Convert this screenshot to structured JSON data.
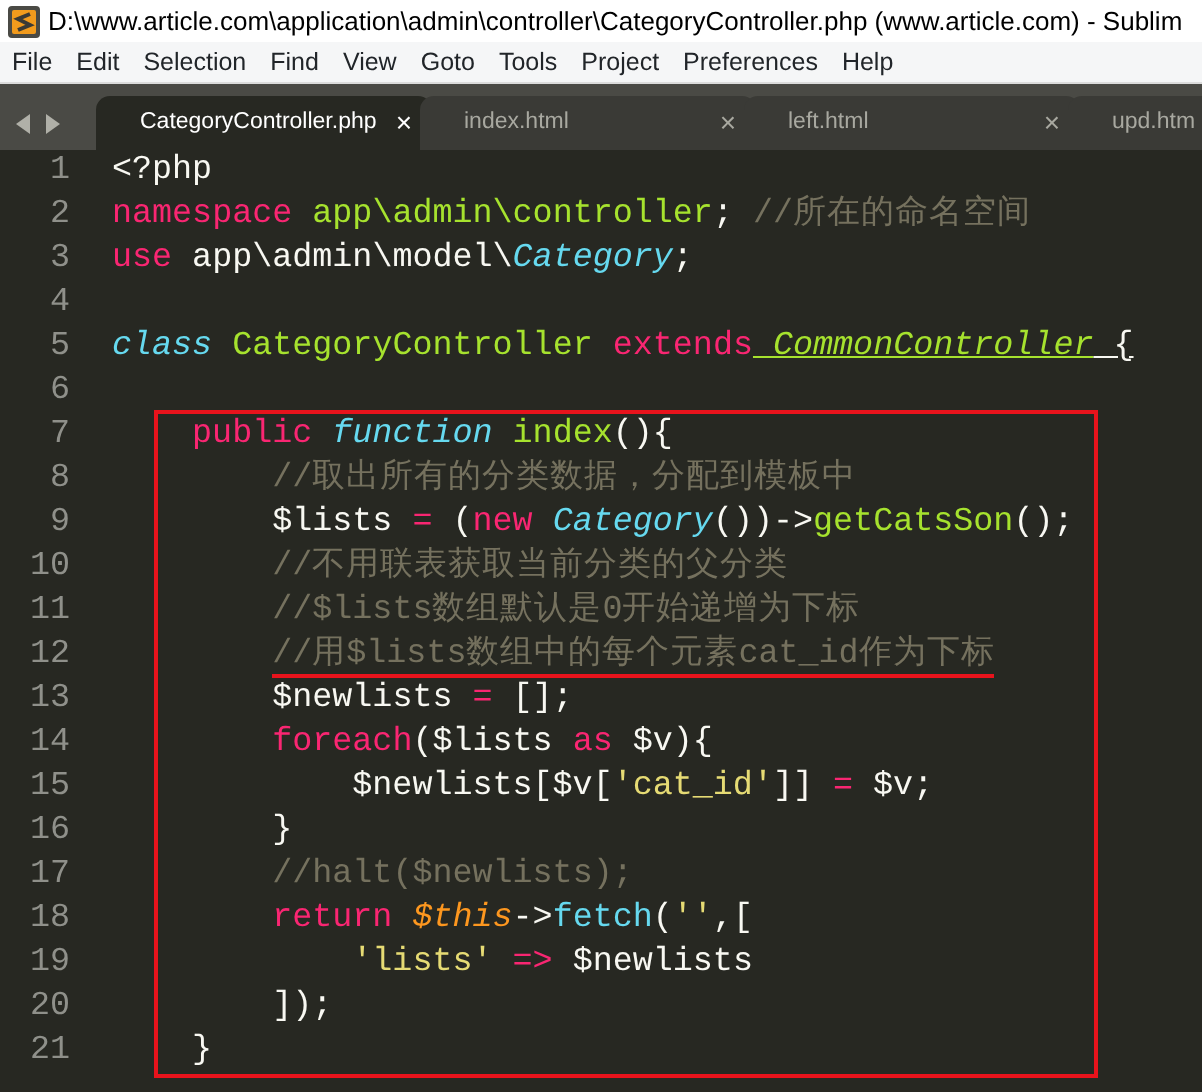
{
  "window": {
    "title": "D:\\www.article.com\\application\\admin\\controller\\CategoryController.php (www.article.com) - Sublim"
  },
  "menu": [
    "File",
    "Edit",
    "Selection",
    "Find",
    "View",
    "Goto",
    "Tools",
    "Project",
    "Preferences",
    "Help"
  ],
  "tabs": [
    {
      "label": "CategoryController.php",
      "close": "×",
      "selected": true
    },
    {
      "label": "index.html",
      "close": "×",
      "selected": false
    },
    {
      "label": "left.html",
      "close": "×",
      "selected": false
    },
    {
      "label": "upd.htm",
      "selected": false
    }
  ],
  "code": {
    "lines": [
      {
        "number": "1",
        "tokens": [
          {
            "kind": "plain",
            "text": "<?php"
          }
        ]
      },
      {
        "number": "2",
        "tokens": [
          {
            "kind": "keyword",
            "text": "namespace"
          },
          {
            "kind": "entity",
            "text": " app\\admin\\controller"
          },
          {
            "kind": "plain",
            "text": ";"
          },
          {
            "kind": "comment",
            "text": " //所在的命名空间"
          }
        ]
      },
      {
        "number": "3",
        "tokens": [
          {
            "kind": "keyword",
            "text": "use"
          },
          {
            "kind": "plain",
            "text": " app\\admin\\model\\"
          },
          {
            "kind": "type",
            "text": "Category"
          },
          {
            "kind": "plain",
            "text": ";"
          }
        ]
      },
      {
        "number": "4"
      },
      {
        "number": "5",
        "tokens": [
          {
            "kind": "type",
            "text": "class"
          },
          {
            "kind": "entity",
            "text": " CategoryController"
          },
          {
            "kind": "keyword",
            "text": " extends"
          },
          {
            "kind": "parent",
            "text": " CommonController"
          },
          {
            "kind": "plain",
            "text": " {",
            "matched_bracket": true
          }
        ],
        "children": [
          {
            "number": "6"
          },
          {
            "boxed": true,
            "lines": [
              {
                "number": "7",
                "tokens": [
                  {
                    "kind": "keyword",
                    "text": "public"
                  },
                  {
                    "kind": "type",
                    "text": " function"
                  },
                  {
                    "kind": "entity",
                    "text": " index"
                  },
                  {
                    "kind": "plain",
                    "text": "(){"
                  }
                ],
                "children": [
                  {
                    "number": "8",
                    "tokens": [
                      {
                        "kind": "comment",
                        "text": "//取出所有的分类数据，分配到模板中"
                      }
                    ]
                  },
                  {
                    "number": "9",
                    "tokens": [
                      {
                        "kind": "plain",
                        "text": "$lists"
                      },
                      {
                        "kind": "keyword",
                        "text": " ="
                      },
                      {
                        "kind": "plain",
                        "text": " ("
                      },
                      {
                        "kind": "keyword",
                        "text": "new"
                      },
                      {
                        "kind": "type",
                        "text": " Category"
                      },
                      {
                        "kind": "plain",
                        "text": "())->"
                      },
                      {
                        "kind": "entity",
                        "text": "getCatsSon"
                      },
                      {
                        "kind": "plain",
                        "text": "();"
                      }
                    ]
                  },
                  {
                    "number": "10",
                    "tokens": [
                      {
                        "kind": "comment",
                        "text": "//不用联表获取当前分类的父分类"
                      }
                    ]
                  },
                  {
                    "number": "11",
                    "tokens": [
                      {
                        "kind": "comment",
                        "text": "//$lists数组默认是0开始递增为下标"
                      }
                    ]
                  },
                  {
                    "number": "12",
                    "tokens": [
                      {
                        "kind": "comment",
                        "text": "//用$lists数组中的每个元素cat_id作为下标",
                        "underlined": true
                      }
                    ]
                  },
                  {
                    "number": "13",
                    "tokens": [
                      {
                        "kind": "plain",
                        "text": "$newlists"
                      },
                      {
                        "kind": "keyword",
                        "text": " ="
                      },
                      {
                        "kind": "plain",
                        "text": " [];"
                      }
                    ]
                  },
                  {
                    "number": "14",
                    "tokens": [
                      {
                        "kind": "keyword",
                        "text": "foreach"
                      },
                      {
                        "kind": "plain",
                        "text": "($lists"
                      },
                      {
                        "kind": "keyword",
                        "text": " as"
                      },
                      {
                        "kind": "plain",
                        "text": " $v){"
                      }
                    ],
                    "children": [
                      {
                        "number": "15",
                        "tokens": [
                          {
                            "kind": "plain",
                            "text": "$newlists[$v["
                          },
                          {
                            "kind": "string",
                            "text": "'cat_id'"
                          },
                          {
                            "kind": "plain",
                            "text": "]]"
                          },
                          {
                            "kind": "keyword",
                            "text": " ="
                          },
                          {
                            "kind": "plain",
                            "text": " $v;"
                          }
                        ]
                      }
                    ]
                  },
                  {
                    "number": "16",
                    "tokens": [
                      {
                        "kind": "plain",
                        "text": "}"
                      }
                    ]
                  },
                  {
                    "number": "17",
                    "tokens": [
                      {
                        "kind": "comment",
                        "text": "//halt($newlists);"
                      }
                    ]
                  },
                  {
                    "number": "18",
                    "tokens": [
                      {
                        "kind": "keyword",
                        "text": "return"
                      },
                      {
                        "kind": "this",
                        "text": " $this"
                      },
                      {
                        "kind": "plain",
                        "text": "->"
                      },
                      {
                        "kind": "support",
                        "text": "fetch"
                      },
                      {
                        "kind": "plain",
                        "text": "("
                      },
                      {
                        "kind": "string",
                        "text": "''"
                      },
                      {
                        "kind": "plain",
                        "text": ",["
                      }
                    ],
                    "children": [
                      {
                        "number": "19",
                        "tokens": [
                          {
                            "kind": "string",
                            "text": "'lists'"
                          },
                          {
                            "kind": "keyword",
                            "text": " =>"
                          },
                          {
                            "kind": "plain",
                            "text": " $newlists"
                          }
                        ]
                      }
                    ]
                  },
                  {
                    "number": "20",
                    "tokens": [
                      {
                        "kind": "plain",
                        "text": "]);"
                      }
                    ]
                  }
                ]
              },
              {
                "number": "21",
                "tokens": [
                  {
                    "kind": "plain",
                    "text": "}"
                  }
                ]
              }
            ]
          }
        ]
      }
    ]
  }
}
